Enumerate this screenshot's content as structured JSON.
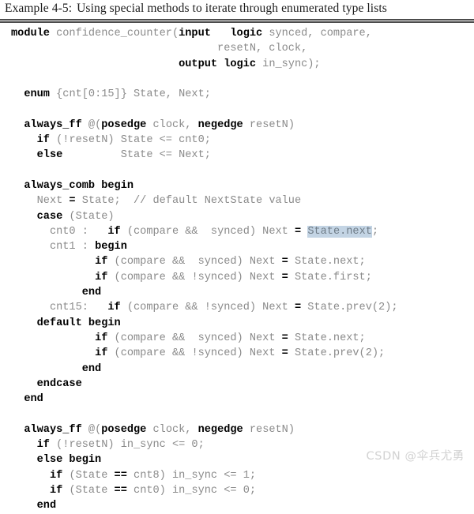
{
  "caption": {
    "label": "Example 4-5:",
    "title": "Using special methods to iterate through enumerated type lists",
    "full": "Example 4-5:  Using special methods to iterate through enumerated type lists"
  },
  "watermark": {
    "text": "CSDN @伞兵尤勇"
  },
  "colors": {
    "keyword": "#000000",
    "plain": "#8a8a8a",
    "selection_background": "#c3d4e4",
    "rule": "#4c4c4c",
    "page_background": "#ffffff",
    "watermark": "#d2d2d2"
  },
  "code": {
    "language": "SystemVerilog",
    "module_name": "confidence_counter",
    "lines": [
      {
        "n": 1,
        "text": "module confidence_counter(input   logic synced, compare,",
        "tokens": [
          {
            "t": "module",
            "k": true
          },
          {
            "t": " confidence_counter("
          },
          {
            "t": "input",
            "k": true
          },
          {
            "t": "   "
          },
          {
            "t": "logic",
            "k": true
          },
          {
            "t": " synced, compare,"
          }
        ]
      },
      {
        "n": 2,
        "text": "                                resetN, clock,",
        "tokens": [
          {
            "t": "                                resetN, clock,"
          }
        ]
      },
      {
        "n": 3,
        "text": "                          output logic in_sync);",
        "tokens": [
          {
            "t": "                          "
          },
          {
            "t": "output logic",
            "k": true
          },
          {
            "t": " in_sync);"
          }
        ]
      },
      {
        "n": 4,
        "text": "",
        "blank": true,
        "tokens": []
      },
      {
        "n": 5,
        "text": "  enum {cnt[0:15]} State, Next;",
        "tokens": [
          {
            "t": "  "
          },
          {
            "t": "enum",
            "k": true
          },
          {
            "t": " {cnt[0:15]} State, Next;"
          }
        ]
      },
      {
        "n": 6,
        "text": "",
        "blank": true,
        "tokens": []
      },
      {
        "n": 7,
        "text": "  always_ff @(posedge clock, negedge resetN)",
        "tokens": [
          {
            "t": "  "
          },
          {
            "t": "always_ff",
            "k": true
          },
          {
            "t": " @("
          },
          {
            "t": "posedge",
            "k": true
          },
          {
            "t": " clock, "
          },
          {
            "t": "negedge",
            "k": true
          },
          {
            "t": " resetN)"
          }
        ]
      },
      {
        "n": 8,
        "text": "    if (!resetN) State <= cnt0;",
        "tokens": [
          {
            "t": "    "
          },
          {
            "t": "if",
            "k": true
          },
          {
            "t": " (!resetN) State <= cnt0;"
          }
        ]
      },
      {
        "n": 9,
        "text": "    else         State <= Next;",
        "tokens": [
          {
            "t": "    "
          },
          {
            "t": "else",
            "k": true
          },
          {
            "t": "         State <= Next;"
          }
        ]
      },
      {
        "n": 10,
        "text": "",
        "blank": true,
        "tokens": []
      },
      {
        "n": 11,
        "text": "  always_comb begin",
        "tokens": [
          {
            "t": "  "
          },
          {
            "t": "always_comb begin",
            "k": true
          }
        ]
      },
      {
        "n": 12,
        "text": "    Next = State;  // default NextState value",
        "tokens": [
          {
            "t": "    Next "
          },
          {
            "t": "=",
            "k": true
          },
          {
            "t": " State;  // default NextState value"
          }
        ]
      },
      {
        "n": 13,
        "text": "    case (State)",
        "tokens": [
          {
            "t": "    "
          },
          {
            "t": "case",
            "k": true
          },
          {
            "t": " (State)"
          }
        ]
      },
      {
        "n": 14,
        "text": "      cnt0 :   if (compare &&  synced) Next = State.next;",
        "tokens": [
          {
            "t": "      cnt0 :   "
          },
          {
            "t": "if",
            "k": true
          },
          {
            "t": " (compare &&  synced) Next "
          },
          {
            "t": "=",
            "k": true
          },
          {
            "t": " "
          },
          {
            "t": "State.next",
            "sel": true
          },
          {
            "t": ";"
          }
        ]
      },
      {
        "n": 15,
        "text": "      cnt1 : begin",
        "tokens": [
          {
            "t": "      cnt1 : "
          },
          {
            "t": "begin",
            "k": true
          }
        ]
      },
      {
        "n": 16,
        "text": "             if (compare &&  synced) Next = State.next;",
        "tokens": [
          {
            "t": "             "
          },
          {
            "t": "if",
            "k": true
          },
          {
            "t": " (compare &&  synced) Next "
          },
          {
            "t": "=",
            "k": true
          },
          {
            "t": " State.next;"
          }
        ]
      },
      {
        "n": 17,
        "text": "             if (compare && !synced) Next = State.first;",
        "tokens": [
          {
            "t": "             "
          },
          {
            "t": "if",
            "k": true
          },
          {
            "t": " (compare && !synced) Next "
          },
          {
            "t": "=",
            "k": true
          },
          {
            "t": " State.first;"
          }
        ]
      },
      {
        "n": 18,
        "text": "           end",
        "tokens": [
          {
            "t": "           "
          },
          {
            "t": "end",
            "k": true
          }
        ]
      },
      {
        "n": 19,
        "text": "      cnt15:   if (compare && !synced) Next = State.prev(2);",
        "tokens": [
          {
            "t": "      cnt15:   "
          },
          {
            "t": "if",
            "k": true
          },
          {
            "t": " (compare && !synced) Next "
          },
          {
            "t": "=",
            "k": true
          },
          {
            "t": " State.prev(2);"
          }
        ]
      },
      {
        "n": 20,
        "text": "    default begin",
        "tokens": [
          {
            "t": "    "
          },
          {
            "t": "default begin",
            "k": true
          }
        ]
      },
      {
        "n": 21,
        "text": "             if (compare &&  synced) Next = State.next;",
        "tokens": [
          {
            "t": "             "
          },
          {
            "t": "if",
            "k": true
          },
          {
            "t": " (compare &&  synced) Next "
          },
          {
            "t": "=",
            "k": true
          },
          {
            "t": " State.next;"
          }
        ]
      },
      {
        "n": 22,
        "text": "             if (compare && !synced) Next = State.prev(2);",
        "tokens": [
          {
            "t": "             "
          },
          {
            "t": "if",
            "k": true
          },
          {
            "t": " (compare && !synced) Next "
          },
          {
            "t": "=",
            "k": true
          },
          {
            "t": " State.prev(2);"
          }
        ]
      },
      {
        "n": 23,
        "text": "           end",
        "tokens": [
          {
            "t": "           "
          },
          {
            "t": "end",
            "k": true
          }
        ]
      },
      {
        "n": 24,
        "text": "    endcase",
        "tokens": [
          {
            "t": "    "
          },
          {
            "t": "endcase",
            "k": true
          }
        ]
      },
      {
        "n": 25,
        "text": "  end",
        "tokens": [
          {
            "t": "  "
          },
          {
            "t": "end",
            "k": true
          }
        ]
      },
      {
        "n": 26,
        "text": "",
        "blank": true,
        "tokens": []
      },
      {
        "n": 27,
        "text": "  always_ff @(posedge clock, negedge resetN)",
        "tokens": [
          {
            "t": "  "
          },
          {
            "t": "always_ff",
            "k": true
          },
          {
            "t": " @("
          },
          {
            "t": "posedge",
            "k": true
          },
          {
            "t": " clock, "
          },
          {
            "t": "negedge",
            "k": true
          },
          {
            "t": " resetN)"
          }
        ]
      },
      {
        "n": 28,
        "text": "    if (!resetN) in_sync <= 0;",
        "tokens": [
          {
            "t": "    "
          },
          {
            "t": "if",
            "k": true
          },
          {
            "t": " (!resetN) in_sync <= 0;"
          }
        ]
      },
      {
        "n": 29,
        "text": "    else begin",
        "tokens": [
          {
            "t": "    "
          },
          {
            "t": "else begin",
            "k": true
          }
        ]
      },
      {
        "n": 30,
        "text": "      if (State == cnt8) in_sync <= 1;",
        "tokens": [
          {
            "t": "      "
          },
          {
            "t": "if",
            "k": true
          },
          {
            "t": " (State "
          },
          {
            "t": "==",
            "k": true
          },
          {
            "t": " cnt8) in_sync <= 1;"
          }
        ]
      },
      {
        "n": 31,
        "text": "      if (State == cnt0) in_sync <= 0;",
        "tokens": [
          {
            "t": "      "
          },
          {
            "t": "if",
            "k": true
          },
          {
            "t": " (State "
          },
          {
            "t": "==",
            "k": true
          },
          {
            "t": " cnt0) in_sync <= 0;"
          }
        ]
      },
      {
        "n": 32,
        "text": "    end",
        "tokens": [
          {
            "t": "    "
          },
          {
            "t": "end",
            "k": true
          }
        ]
      }
    ]
  }
}
